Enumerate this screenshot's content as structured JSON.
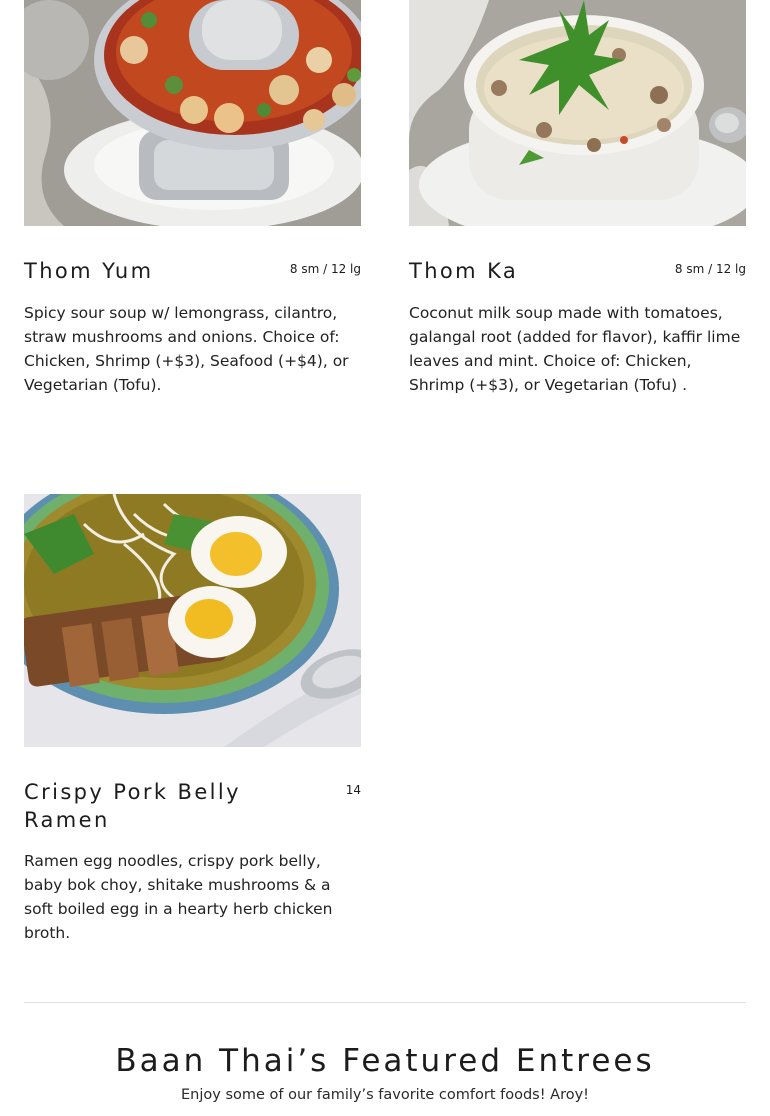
{
  "menu_items": [
    {
      "name": "Thom Yum",
      "price": "8 sm / 12 lg",
      "description": "Spicy sour soup w/ lemongrass, cilantro, straw mushrooms and onions. Choice of: Chicken, Shrimp (+$3), Seafood (+$4), or Vegetarian (Tofu)."
    },
    {
      "name": "Thom Ka",
      "price": "8 sm / 12 lg",
      "description": "Coconut milk soup made with tomatoes, galangal root (added for flavor), kaffir lime leaves and mint. Choice of:  Chicken, Shrimp (+$3),  or Vegetarian (Tofu) ."
    },
    {
      "name": "Crispy Pork Belly Ramen",
      "price": "14",
      "description": "Ramen egg noodles, crispy pork belly, baby bok choy, shitake mushrooms & a soft boiled egg in a hearty herb chicken broth."
    }
  ],
  "featured_section": {
    "title": "Baan Thai’s Featured Entrees",
    "subtitle": "Enjoy some of our family’s favorite comfort foods! Aroy!"
  }
}
